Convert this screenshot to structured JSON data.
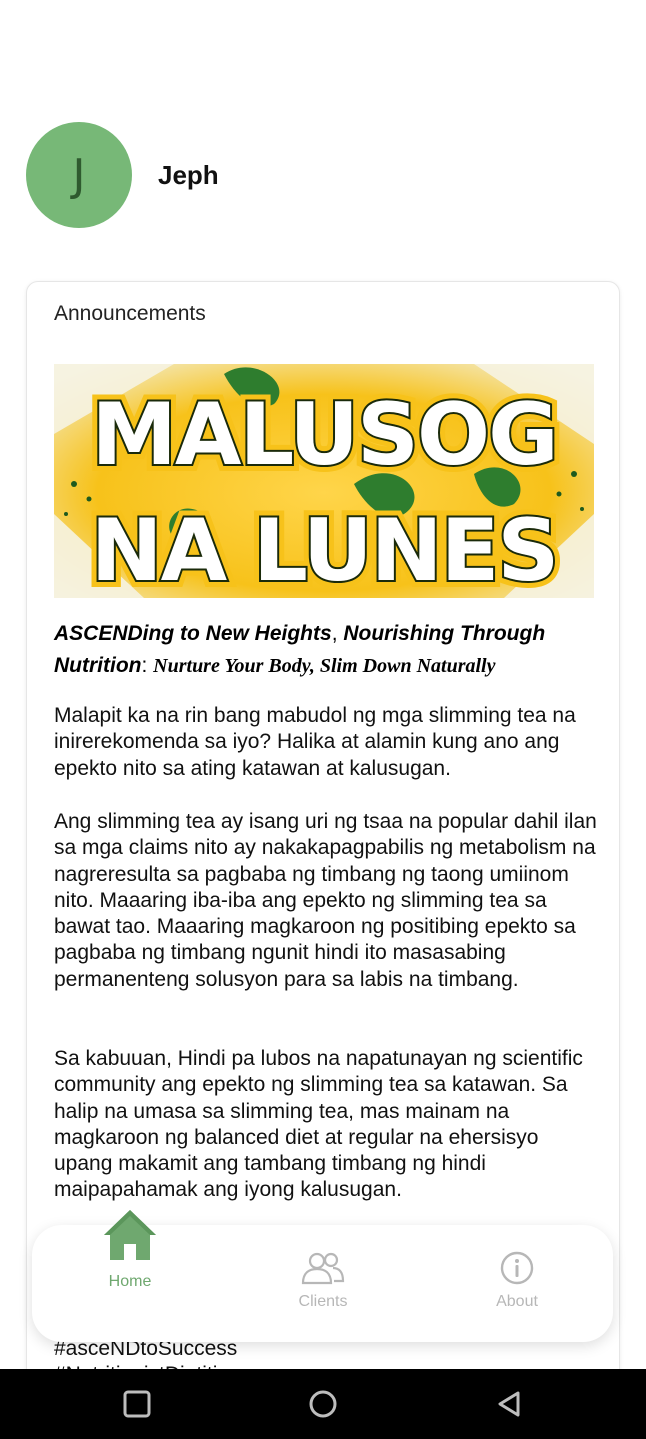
{
  "profile": {
    "avatar_initial": "J",
    "name": "Jeph"
  },
  "announcements": {
    "title": "Announcements",
    "banner": {
      "line1": "MALUSOG",
      "line2": "NA LUNES",
      "colors": {
        "yellow": "#f7c21a",
        "green": "#2e7d2e",
        "outline": "#1a2a0a"
      }
    },
    "headline": {
      "part1": "ASCENDing to New Heights",
      "sep1": ", ",
      "part2": "Nourishing Through Nutrition",
      "sep2": ": ",
      "part3": "Nurture Your Body, Slim Down Naturally"
    },
    "paragraphs": [
      "Malapit ka na rin bang mabudol ng mga slimming tea na inirerekomenda sa iyo? Halika at alamin kung ano ang epekto nito sa ating katawan at kalusugan.",
      "Ang slimming tea ay isang uri ng tsaa na popular dahil ilan sa mga claims nito ay nakakapagpabilis ng metabolism na nagreresulta sa pagbaba ng timbang ng taong umiinom nito. Maaaring iba-iba ang epekto ng slimming tea sa bawat tao. Maaaring magkaroon ng positibing epekto sa pagbaba ng timbang ngunit hindi ito masasabing permanenteng solusyon para sa labis na timbang.",
      "Sa kabuuan, Hindi pa lubos na napatunayan ng scientific community ang epekto ng slimming tea sa katawan. Sa halip na umasa sa slimming tea, mas mainam na magkaroon ng balanced diet at regular na ehersisyo upang makamit ang tambang timbang ng hindi maipapahamak ang iyong kalusugan."
    ],
    "hashtags": [
      "#asceNDtoSuccess",
      "#NutritionistDietitian"
    ]
  },
  "bottom_nav": {
    "items": [
      {
        "label": "Home",
        "icon": "house-icon",
        "active": true
      },
      {
        "label": "Clients",
        "icon": "people-icon",
        "active": false
      },
      {
        "label": "About",
        "icon": "info-icon",
        "active": false
      }
    ],
    "active_color": "#6fa86f",
    "inactive_color": "#b7b7b7"
  },
  "system_nav": {
    "buttons": [
      "recents-icon",
      "home-circle-icon",
      "back-triangle-icon"
    ]
  },
  "colors": {
    "avatar_bg": "#77b877",
    "accent": "#6fa86f"
  }
}
